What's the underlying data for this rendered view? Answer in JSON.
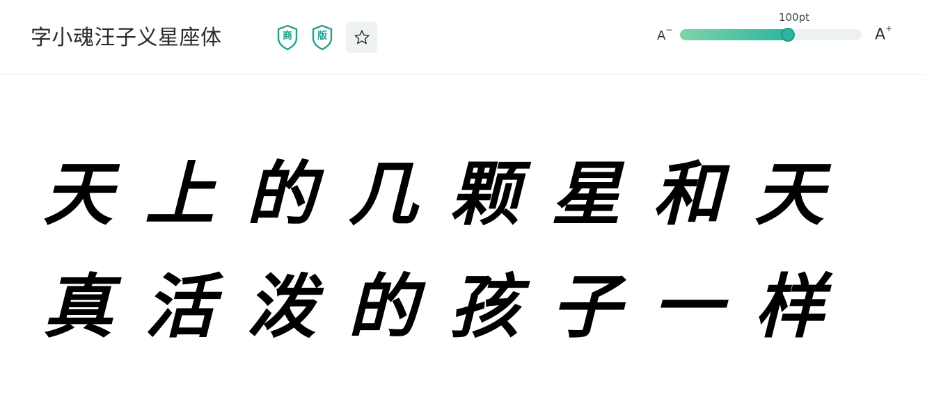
{
  "font": {
    "name": "字小魂汪子义星座体"
  },
  "badges": [
    {
      "glyph": "商",
      "color": "#1fa28f"
    },
    {
      "glyph": "版",
      "color": "#1fa28f"
    }
  ],
  "favorite": {
    "icon": "star-outline-icon"
  },
  "size_control": {
    "decrease_label": "A",
    "decrease_sup": "−",
    "increase_label": "A",
    "increase_sup": "+",
    "value_label": "100pt",
    "value_fraction": 0.595,
    "accent_start": "#7fd4a8",
    "accent_end": "#2db59f"
  },
  "preview": {
    "lines": [
      "天上的几颗星和天",
      "真活泼的孩子一样"
    ]
  }
}
